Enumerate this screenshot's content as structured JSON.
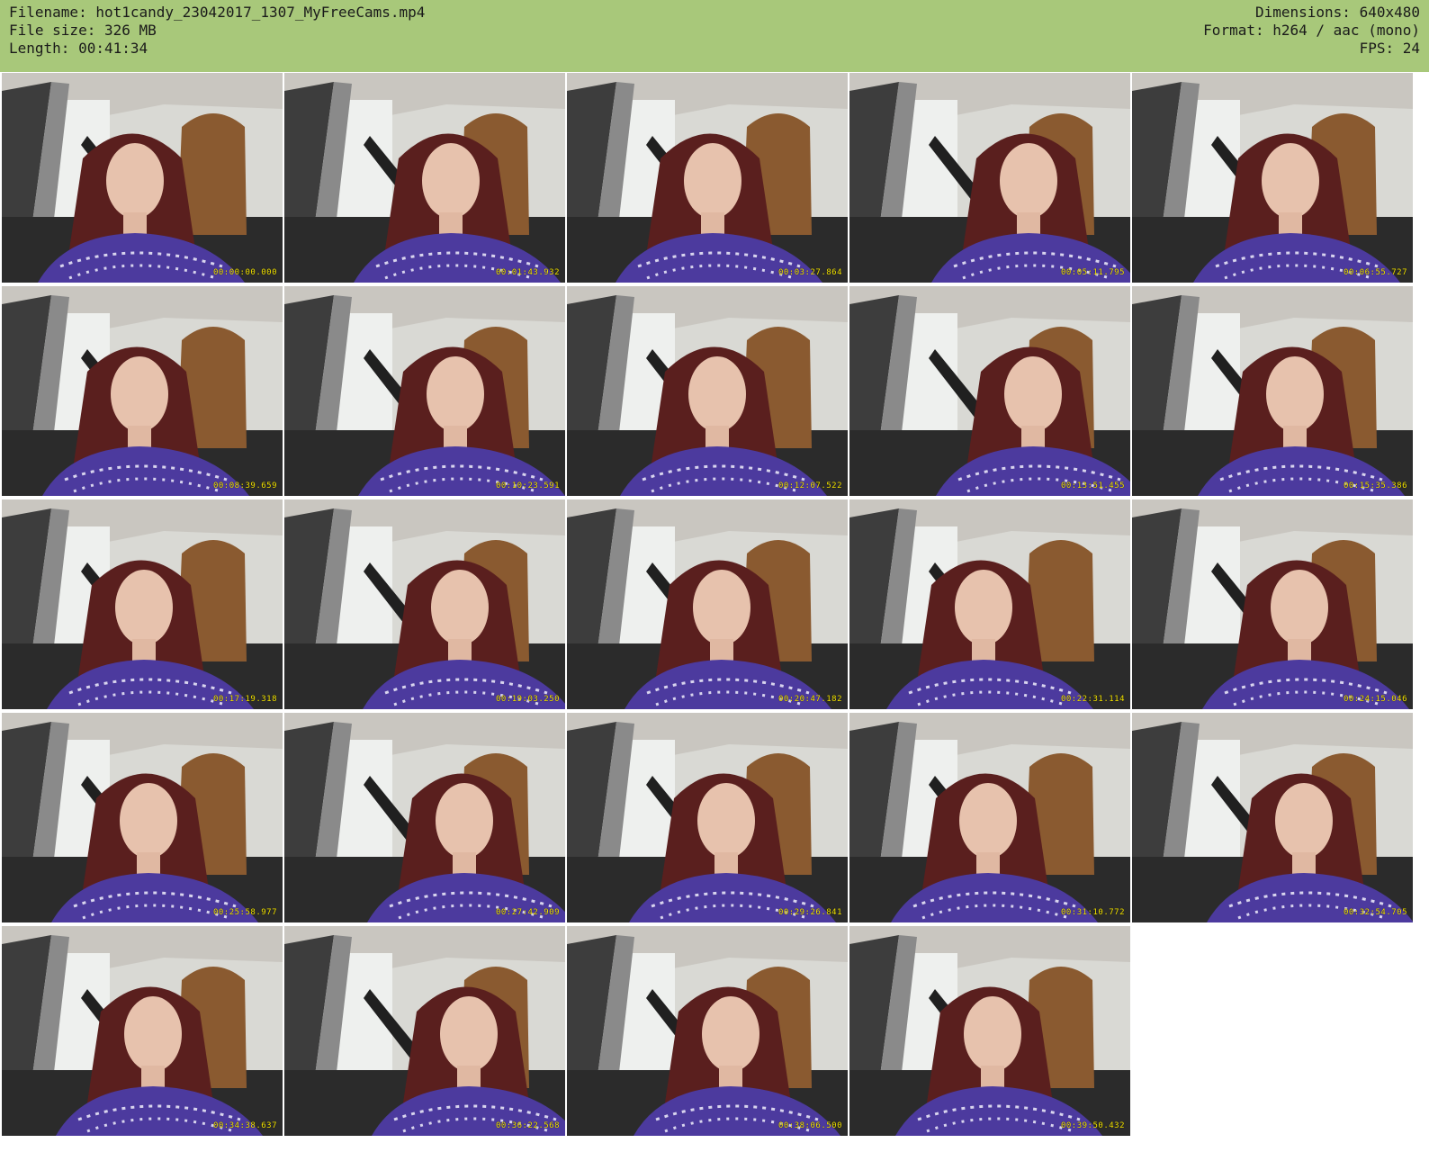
{
  "header": {
    "filename_line": "Filename: hot1candy_23042017_1307_MyFreeCams.mp4",
    "filesize_line": "File size: 326 MB",
    "length_line": "Length: 00:41:34",
    "dimensions_line": "Dimensions: 640x480",
    "format_line": "Format: h264 / aac (mono)",
    "fps_line": "FPS: 24"
  },
  "colors": {
    "header_bg": "#a8c87a",
    "timestamp": "#f4e400",
    "sweater": "#4c3a9e",
    "hair": "#5a1f1e"
  },
  "thumbnails": [
    {
      "timestamp": "00:00:00.000"
    },
    {
      "timestamp": "00:01:43.932"
    },
    {
      "timestamp": "00:03:27.864"
    },
    {
      "timestamp": "00:05:11.795"
    },
    {
      "timestamp": "00:06:55.727"
    },
    {
      "timestamp": "00:08:39.659"
    },
    {
      "timestamp": "00:10:23.591"
    },
    {
      "timestamp": "00:12:07.522"
    },
    {
      "timestamp": "00:13:51.455"
    },
    {
      "timestamp": "00:15:35.386"
    },
    {
      "timestamp": "00:17:19.318"
    },
    {
      "timestamp": "00:19:03.250"
    },
    {
      "timestamp": "00:20:47.182"
    },
    {
      "timestamp": "00:22:31.114"
    },
    {
      "timestamp": "00:24:15.046"
    },
    {
      "timestamp": "00:25:58.977"
    },
    {
      "timestamp": "00:27:42.909"
    },
    {
      "timestamp": "00:29:26.841"
    },
    {
      "timestamp": "00:31:10.772"
    },
    {
      "timestamp": "00:32:54.705"
    },
    {
      "timestamp": "00:34:38.637"
    },
    {
      "timestamp": "00:36:22.568"
    },
    {
      "timestamp": "00:38:06.500"
    },
    {
      "timestamp": "00:39:50.432"
    }
  ]
}
